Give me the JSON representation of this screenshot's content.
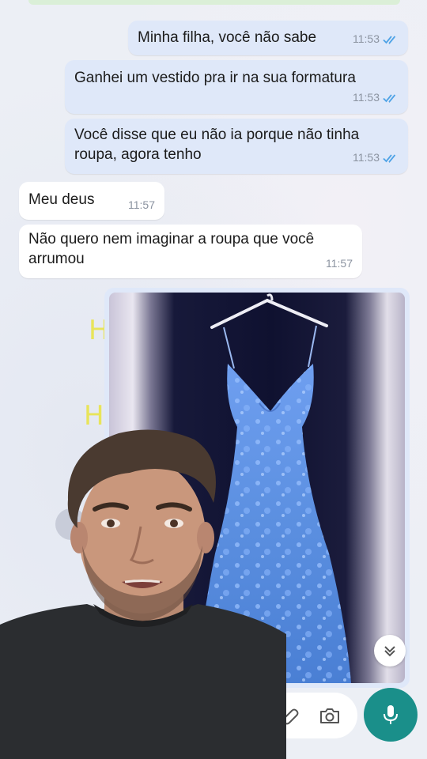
{
  "messages": [
    {
      "dir": "out",
      "text": "Minha filha, você não sabe",
      "time": "11:53",
      "status": "read"
    },
    {
      "dir": "out",
      "text": "Ganhei um vestido pra ir na sua formatura",
      "time": "11:53",
      "status": "read"
    },
    {
      "dir": "out",
      "text": "Você disse que eu não ia porque não tinha roupa, agora tenho",
      "time": "11:53",
      "status": "read"
    },
    {
      "dir": "in",
      "text": "Meu deus",
      "time": "11:57"
    },
    {
      "dir": "in",
      "text": "Não quero nem imaginar a roupa que você arrumou",
      "time": "11:57"
    }
  ],
  "image_message": {
    "content": "blue-gown-on-hanger-photo"
  },
  "overlay": {
    "content": "presenter-face-overlay"
  },
  "bg_marks": [
    "H",
    "H"
  ],
  "composer": {
    "attach_icon": "paperclip-icon",
    "camera_icon": "camera-icon",
    "mic_icon": "microphone-icon"
  },
  "scroll_icon": "double-chevron-down-icon",
  "colors": {
    "outgoing_bubble": "#dfe8f9",
    "incoming_bubble": "#ffffff",
    "read_ticks": "#4fa3e6",
    "mic_button": "#1a8f8a",
    "dress_blue": "#5b8fe0"
  }
}
